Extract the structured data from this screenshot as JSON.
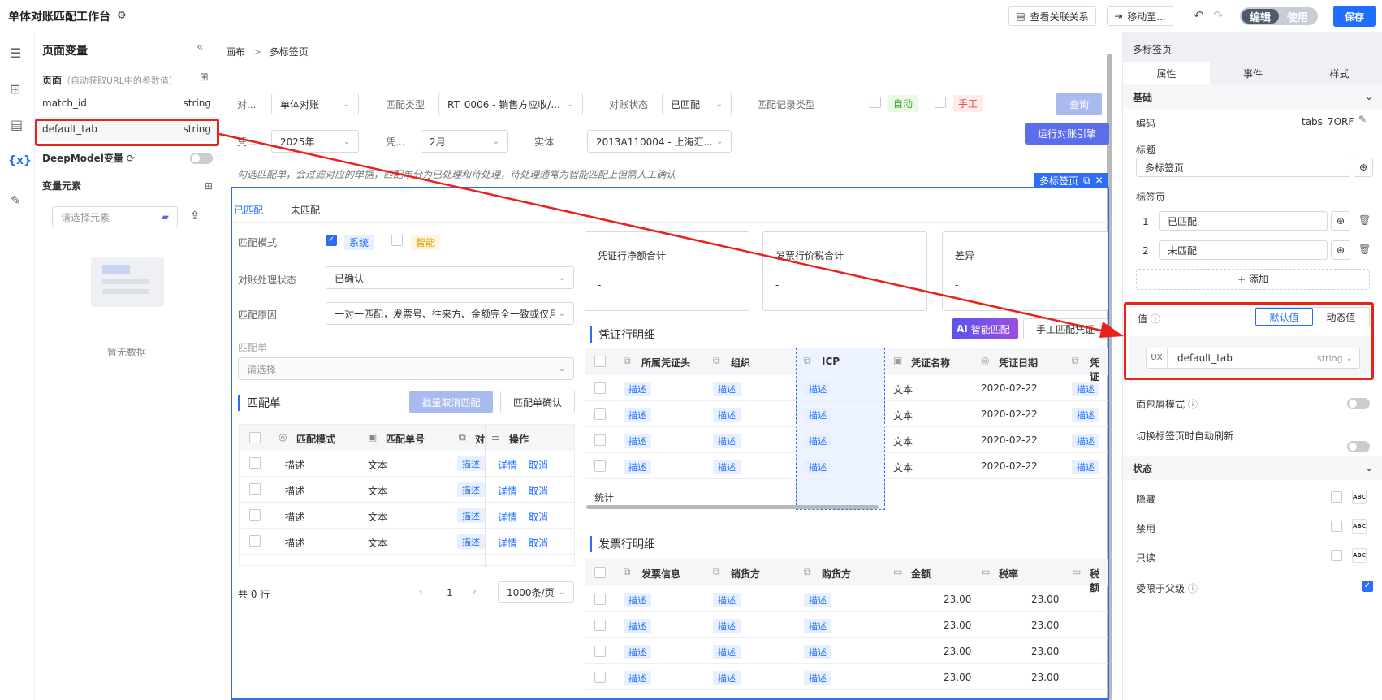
{
  "topbar": {
    "title": "单体对账匹配工作台",
    "view_relation": "查看关联关系",
    "move_to": "移动至...",
    "mode_edit": "编辑",
    "mode_use": "使用",
    "save": "保存"
  },
  "left": {
    "title": "页面变量",
    "page_label": "页面",
    "page_hint": "（自动获取URL中的参数值）",
    "vars": [
      {
        "name": "match_id",
        "type": "string"
      },
      {
        "name": "default_tab",
        "type": "string"
      }
    ],
    "deepmodel": "DeepModel变量",
    "var_elements": "变量元素",
    "select_placeholder": "请选择元素",
    "empty": "暂无数据"
  },
  "breadcrumb": {
    "root": "画布",
    "sep": ">",
    "current": "多标签页"
  },
  "filters": {
    "l1": "对...",
    "v1": "单体对账",
    "l2": "匹配类型",
    "v2": "RT_0006 - 销售方应收/...",
    "l3": "对账状态",
    "v3": "已匹配",
    "l4": "匹配记录类型",
    "auto": "自动",
    "manual": "手工",
    "query": "查询",
    "l5": "凭...",
    "v5": "2025年",
    "l6": "凭...",
    "v6": "2月",
    "l7": "实体",
    "v7": "2013A110004 - 上海汇...",
    "run": "运行对账引擎"
  },
  "hint": "勾选匹配单，会过滤对应的单据，匹配单分为已处理和待处理，待处理通常为智能匹配上但需人工确认",
  "tabs_widget": {
    "badge": "多标签页",
    "tab1": "已匹配",
    "tab2": "未匹配"
  },
  "form": {
    "mode_label": "匹配模式",
    "sys": "系统",
    "smart": "智能",
    "status_label": "对账处理状态",
    "status_value": "已确认",
    "reason_label": "匹配原因",
    "reason_value": "一对一匹配，发票号、往来方、金额完全一致或仅月",
    "doc_label": "匹配单",
    "doc_placeholder": "请选择"
  },
  "match_table": {
    "title": "匹配单",
    "batch_cancel": "批量取消匹配",
    "confirm": "匹配单确认",
    "headers": [
      "匹配模式",
      "匹配单号",
      "对",
      "操作"
    ],
    "rows": [
      [
        "描述",
        "文本",
        "描述"
      ],
      [
        "描述",
        "文本",
        "描述"
      ],
      [
        "描述",
        "文本",
        "描述"
      ],
      [
        "描述",
        "文本",
        "描述"
      ]
    ],
    "op_detail": "详情",
    "op_cancel": "取消",
    "total": "共 0 行",
    "page": "1",
    "page_size": "1000条/页"
  },
  "stats": [
    {
      "label": "凭证行净额合计",
      "value": "-"
    },
    {
      "label": "发票行价税合计",
      "value": "-"
    },
    {
      "label": "差异",
      "value": "-"
    }
  ],
  "voucher": {
    "title": "凭证行明细",
    "ai": "智能匹配",
    "manual_btn": "手工匹配凭证",
    "headers": [
      "所属凭证头",
      "组织",
      "ICP",
      "凭证名称",
      "凭证日期",
      "凭证"
    ],
    "rows": [
      [
        "描述",
        "描述",
        "描述",
        "文本",
        "2020-02-22",
        "描述"
      ],
      [
        "描述",
        "描述",
        "描述",
        "文本",
        "2020-02-22",
        "描述"
      ],
      [
        "描述",
        "描述",
        "描述",
        "文本",
        "2020-02-22",
        "描述"
      ],
      [
        "描述",
        "描述",
        "描述",
        "文本",
        "2020-02-22",
        "描述"
      ]
    ],
    "stat": "统计"
  },
  "invoice": {
    "title": "发票行明细",
    "headers": [
      "发票信息",
      "销货方",
      "购货方",
      "金额",
      "税率",
      "税额"
    ],
    "rows": [
      [
        "描述",
        "描述",
        "描述",
        "23.00",
        "23.00"
      ],
      [
        "描述",
        "描述",
        "描述",
        "23.00",
        "23.00"
      ],
      [
        "描述",
        "描述",
        "描述",
        "23.00",
        "23.00"
      ],
      [
        "描述",
        "描述",
        "描述",
        "23.00",
        "23.00"
      ]
    ]
  },
  "right": {
    "header": "多标签页",
    "tabs": [
      "属性",
      "事件",
      "样式"
    ],
    "section_basic": "基础",
    "code_label": "编码",
    "code_value": "tabs_7ORF",
    "title_label": "标题",
    "title_value": "多标签页",
    "tabpages_label": "标签页",
    "tabpages": [
      {
        "idx": "1",
        "label": "已匹配"
      },
      {
        "idx": "2",
        "label": "未匹配"
      }
    ],
    "add": "+ 添加",
    "value_label": "值",
    "default_btn": "默认值",
    "dynamic_btn": "动态值",
    "ux": "UX",
    "value_var": "default_tab",
    "value_type": "string",
    "breadcrumb_mode": "面包屑模式",
    "auto_refresh": "切换标签页时自动刷新",
    "section_state": "状态",
    "states": [
      {
        "label": "隐藏"
      },
      {
        "label": "禁用"
      },
      {
        "label": "只读"
      }
    ],
    "limit_parent": "受限于父级"
  },
  "colors": {
    "accent": "#1e6fff",
    "annotation": "#e8231b"
  }
}
